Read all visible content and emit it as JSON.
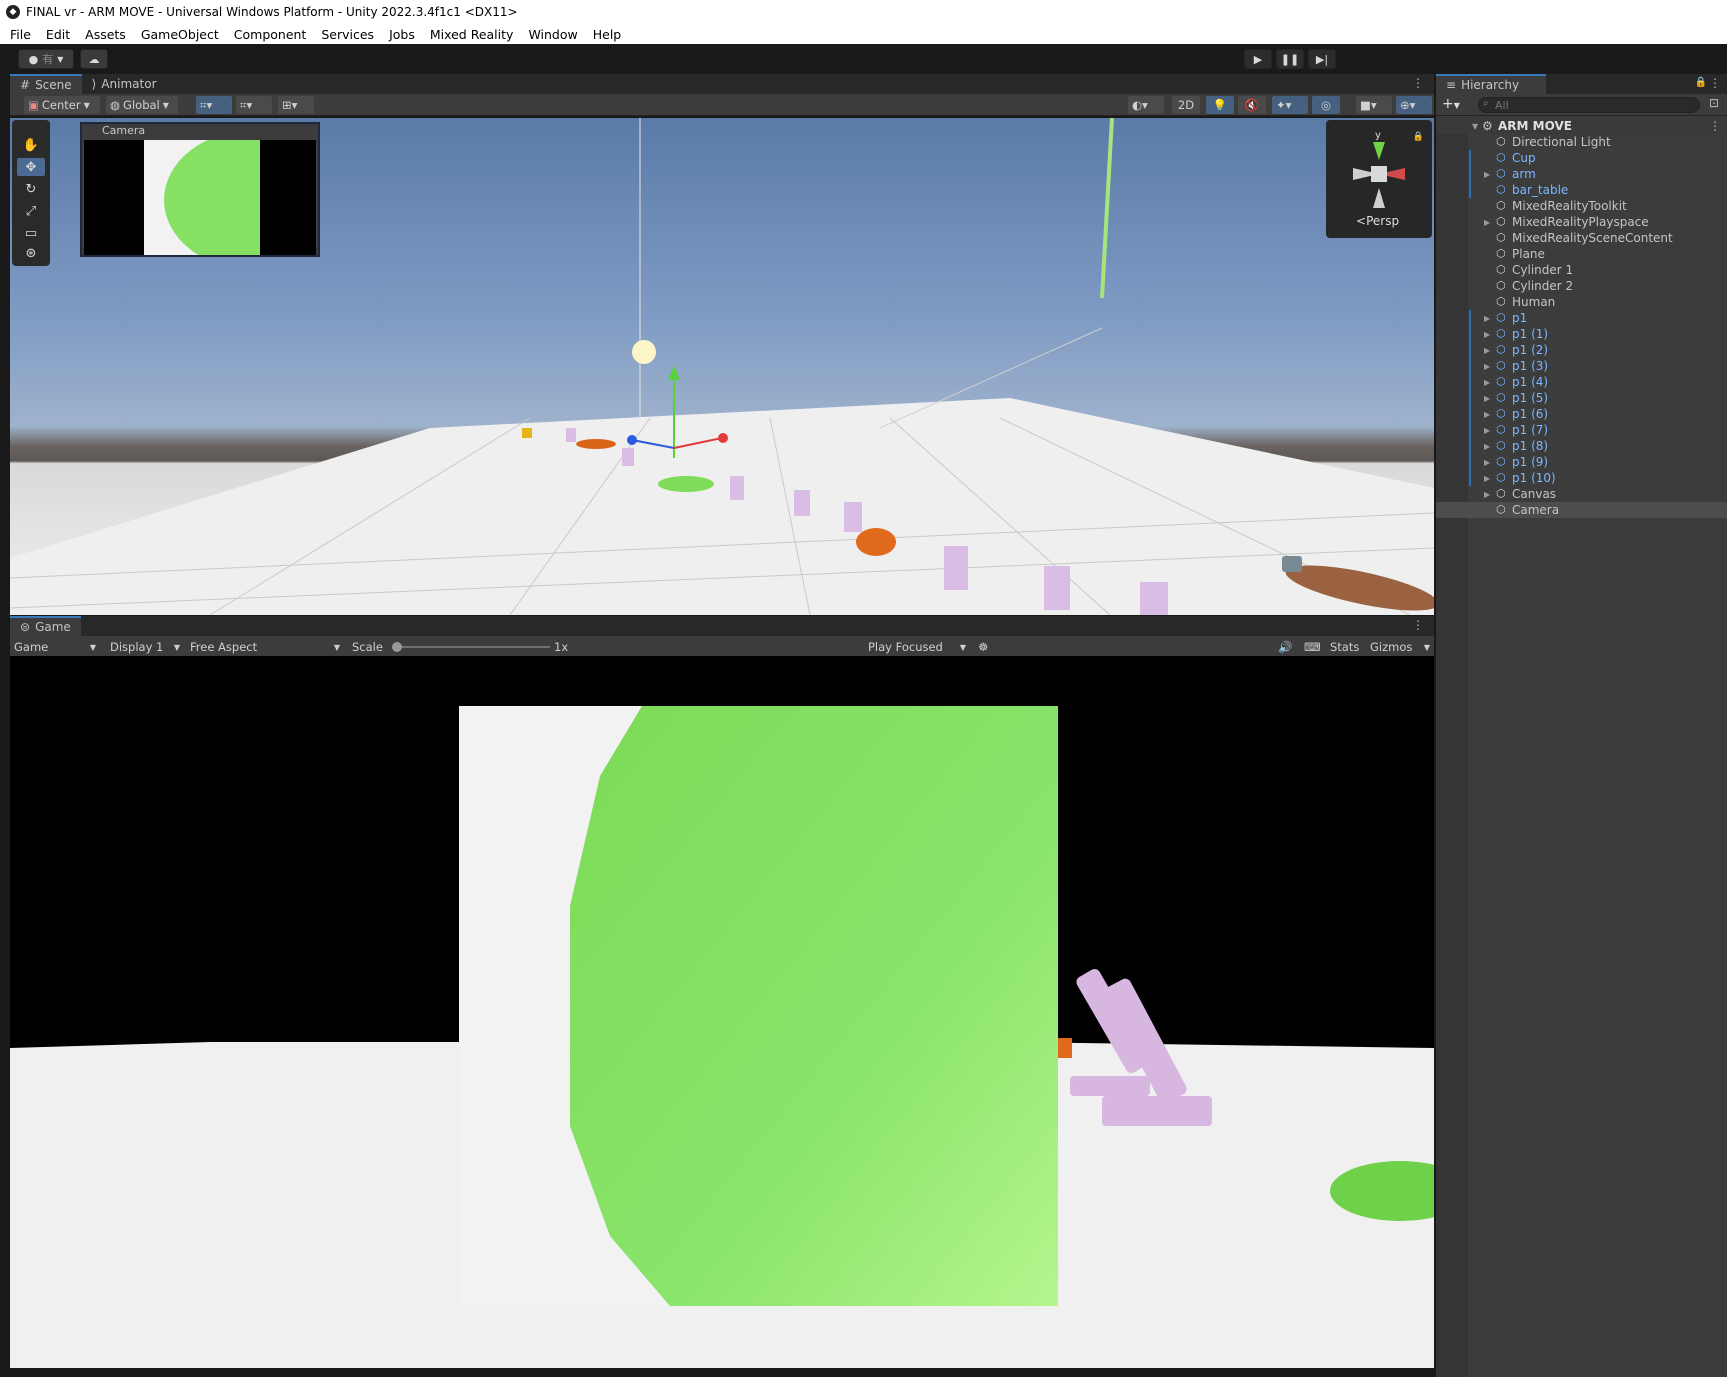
{
  "window": {
    "title": "FINAL vr - ARM MOVE - Universal Windows Platform - Unity 2022.3.4f1c1 <DX11>"
  },
  "menu": [
    "File",
    "Edit",
    "Assets",
    "GameObject",
    "Component",
    "Services",
    "Jobs",
    "Mixed Reality",
    "Window",
    "Help"
  ],
  "toolbar": {
    "account_label": "有",
    "play_icon": "play-icon",
    "pause_icon": "pause-icon",
    "step_icon": "step-icon"
  },
  "scene_panel": {
    "tabs": [
      "Scene",
      "Animator"
    ],
    "pivot_mode": "Center",
    "pivot_rotation": "Global",
    "mode_2d": "2D",
    "camera_overlay_title": "Camera",
    "gizmo_axis_label": "y",
    "projection_label": "Persp"
  },
  "game_panel": {
    "tab": "Game",
    "view_type": "Game",
    "display": "Display 1",
    "aspect": "Free Aspect",
    "scale_label": "Scale",
    "scale_value": "1x",
    "scale_slider_level": 0.0,
    "play_mode": "Play Focused",
    "stats_label": "Stats",
    "gizmos_label": "Gizmos"
  },
  "hierarchy": {
    "tab": "Hierarchy",
    "search_placeholder": "All",
    "scene_name": "ARM MOVE",
    "items": [
      {
        "label": "Directional Light",
        "prefab": false,
        "expandable": false
      },
      {
        "label": "Cup",
        "prefab": true,
        "expandable": false
      },
      {
        "label": "arm",
        "prefab": true,
        "expandable": true
      },
      {
        "label": "bar_table",
        "prefab": true,
        "expandable": false
      },
      {
        "label": "MixedRealityToolkit",
        "prefab": false,
        "expandable": false
      },
      {
        "label": "MixedRealityPlayspace",
        "prefab": false,
        "expandable": true
      },
      {
        "label": "MixedRealitySceneContent",
        "prefab": false,
        "expandable": false
      },
      {
        "label": "Plane",
        "prefab": false,
        "expandable": false
      },
      {
        "label": "Cylinder 1",
        "prefab": false,
        "expandable": false
      },
      {
        "label": "Cylinder 2",
        "prefab": false,
        "expandable": false
      },
      {
        "label": "Human",
        "prefab": false,
        "expandable": false
      },
      {
        "label": "p1",
        "prefab": true,
        "expandable": true
      },
      {
        "label": "p1 (1)",
        "prefab": true,
        "expandable": true
      },
      {
        "label": "p1 (2)",
        "prefab": true,
        "expandable": true
      },
      {
        "label": "p1 (3)",
        "prefab": true,
        "expandable": true
      },
      {
        "label": "p1 (4)",
        "prefab": true,
        "expandable": true
      },
      {
        "label": "p1 (5)",
        "prefab": true,
        "expandable": true
      },
      {
        "label": "p1 (6)",
        "prefab": true,
        "expandable": true
      },
      {
        "label": "p1 (7)",
        "prefab": true,
        "expandable": true
      },
      {
        "label": "p1 (8)",
        "prefab": true,
        "expandable": true
      },
      {
        "label": "p1 (9)",
        "prefab": true,
        "expandable": true
      },
      {
        "label": "p1 (10)",
        "prefab": true,
        "expandable": true
      },
      {
        "label": "Canvas",
        "prefab": false,
        "expandable": true
      },
      {
        "label": "Camera",
        "prefab": false,
        "expandable": false,
        "selected": true
      }
    ]
  },
  "colors": {
    "accent": "#3a79bb",
    "prefab_text": "#7cb6ff",
    "green_object": "#86e063",
    "arm_color": "#d7b6e0",
    "orange_object": "#e06a1c"
  }
}
